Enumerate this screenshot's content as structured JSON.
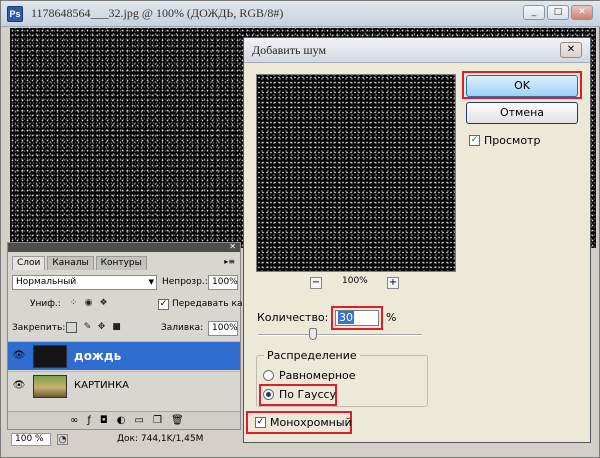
{
  "document": {
    "title": "1178648564___32.jpg @ 100% (ДОЖДЬ, RGB/8#)",
    "app_icon_text": "Ps",
    "window_buttons": [
      "_",
      "□",
      "✕"
    ]
  },
  "layers_panel": {
    "tabs": [
      "Слои",
      "Каналы",
      "Контуры"
    ],
    "close_glyph": "✕",
    "blend_mode": "Нормальный",
    "opacity_label": "Непрозр.:",
    "opacity_value": "100%",
    "unify_label": "Униф.:",
    "propagate_label": "Передавать ка",
    "lock_label": "Закрепить:",
    "fill_label": "Заливка:",
    "fill_value": "100%",
    "layers": [
      {
        "name": "дождь",
        "selected": true
      },
      {
        "name": "КАРТИНКА",
        "selected": false
      }
    ]
  },
  "statusbar": {
    "zoom": "100 %",
    "doc_info": "Док: 744,1K/1,45M"
  },
  "dialog": {
    "title": "Добавить шум",
    "close_glyph": "✕",
    "ok_label": "OK",
    "cancel_label": "Отмена",
    "preview_label": "Просмотр",
    "preview_checked": true,
    "zoom_out": "−",
    "zoom_in": "+",
    "zoom_level": "100%",
    "amount_label": "Количество:",
    "amount_value": "30",
    "amount_unit": "%",
    "amount_slider_fraction": 0.3,
    "distribution_label": "Распределение",
    "uniform_label": "Равномерное",
    "gaussian_label": "По Гауссу",
    "selected_distribution": "gaussian",
    "monochrome_label": "Монохромный",
    "monochrome_checked": true
  },
  "colors": {
    "highlight_box": "#e11c2c",
    "selected_layer": "#2f6ccf",
    "ok_button": "#9dd2f6"
  }
}
